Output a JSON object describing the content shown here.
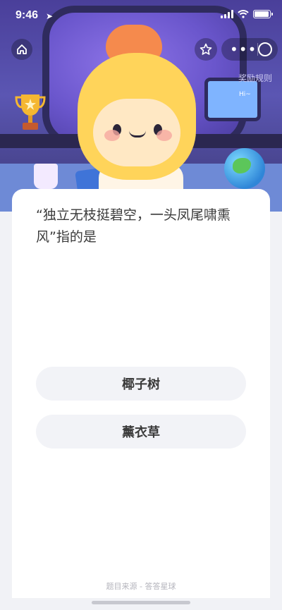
{
  "status_bar": {
    "time": "9:46",
    "battery_level_percent": 95
  },
  "header": {
    "rules_link": "奖励规则",
    "monitor_greeting": "Hi~"
  },
  "question": {
    "text": "“独立无枝挺碧空，一头凤尾啸熏风”指的是"
  },
  "options": [
    {
      "label": "椰子树"
    },
    {
      "label": "薰衣草"
    }
  ],
  "footer": {
    "source": "题目来源 - 答答星球"
  },
  "colors": {
    "hero_background": "#4a3f9a",
    "card_background": "#ffffff",
    "option_background": "#f2f3f7",
    "page_background": "#f1f2f6"
  },
  "icons": [
    "location-arrow-icon",
    "signal-icon",
    "wifi-icon",
    "battery-icon",
    "home-icon",
    "star-icon",
    "more-icon",
    "close-icon"
  ]
}
